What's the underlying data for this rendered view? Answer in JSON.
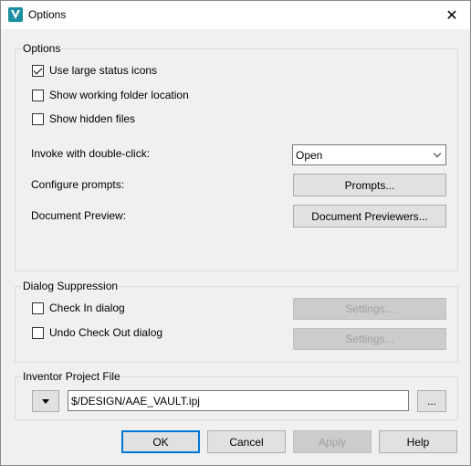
{
  "window": {
    "title": "Options",
    "close_glyph": "✕"
  },
  "options_group": {
    "title": "Options",
    "use_large_status_icons": {
      "label": "Use large status icons",
      "checked": true
    },
    "show_working_folder_location": {
      "label": "Show working folder location",
      "checked": false
    },
    "show_hidden_files": {
      "label": "Show hidden files",
      "checked": false
    },
    "invoke_label": "Invoke with double-click:",
    "invoke_value": "Open",
    "configure_prompts_label": "Configure prompts:",
    "prompts_button": "Prompts...",
    "document_preview_label": "Document Preview:",
    "document_previewers_button": "Document Previewers..."
  },
  "dialog_suppression": {
    "title": "Dialog Suppression",
    "check_in_dialog": {
      "label": "Check In dialog",
      "checked": false
    },
    "undo_check_out_dialog": {
      "label": "Undo Check Out dialog",
      "checked": false
    },
    "settings_button_1": "Settings...",
    "settings_button_2": "Settings..."
  },
  "project_file": {
    "title": "Inventor Project File",
    "path": "$/DESIGN/AAE_VAULT.ipj",
    "browse_label": "..."
  },
  "footer": {
    "ok": "OK",
    "cancel": "Cancel",
    "apply": "Apply",
    "help": "Help"
  },
  "colors": {
    "accent": "#0078d7",
    "app_icon": "#1aa3b5"
  }
}
